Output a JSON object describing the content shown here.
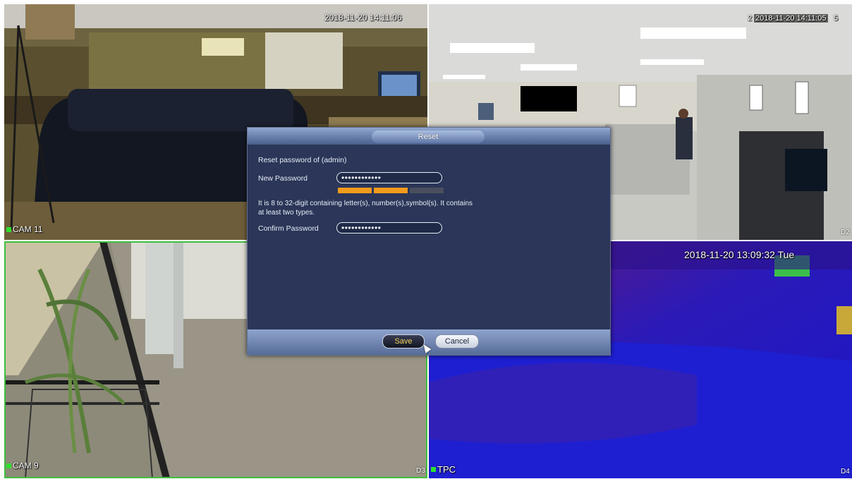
{
  "cameras": {
    "cam1": {
      "timestamp": "2018-11-20 14:11:06",
      "label": "CAM 11"
    },
    "cam2": {
      "timestamp": "2018-11-20 14:11:05",
      "ts_prefix": "2",
      "ts_suffix": "5",
      "channel": "D2"
    },
    "cam3": {
      "label": "CAM 9",
      "channel": "D3"
    },
    "cam4": {
      "timestamp": "2018-11-20 13:09:32 Tue",
      "label": "TPC",
      "channel": "D4"
    }
  },
  "dialog": {
    "title": "Reset",
    "reset_for": "Reset password of (admin)",
    "new_password_label": "New Password",
    "new_password_value": "••••••••••••",
    "strength_level": 0.67,
    "hint_line1": "It is 8 to 32-digit containing letter(s), number(s),symbol(s). It contains",
    "hint_line2": "at least two types.",
    "confirm_password_label": "Confirm Password",
    "confirm_password_value": "••••••••••••",
    "save_label": "Save",
    "cancel_label": "Cancel"
  },
  "colors": {
    "selected_border": "#3fbf3f",
    "strength_on": "#f29a1b",
    "save_text": "#f2d15a"
  }
}
